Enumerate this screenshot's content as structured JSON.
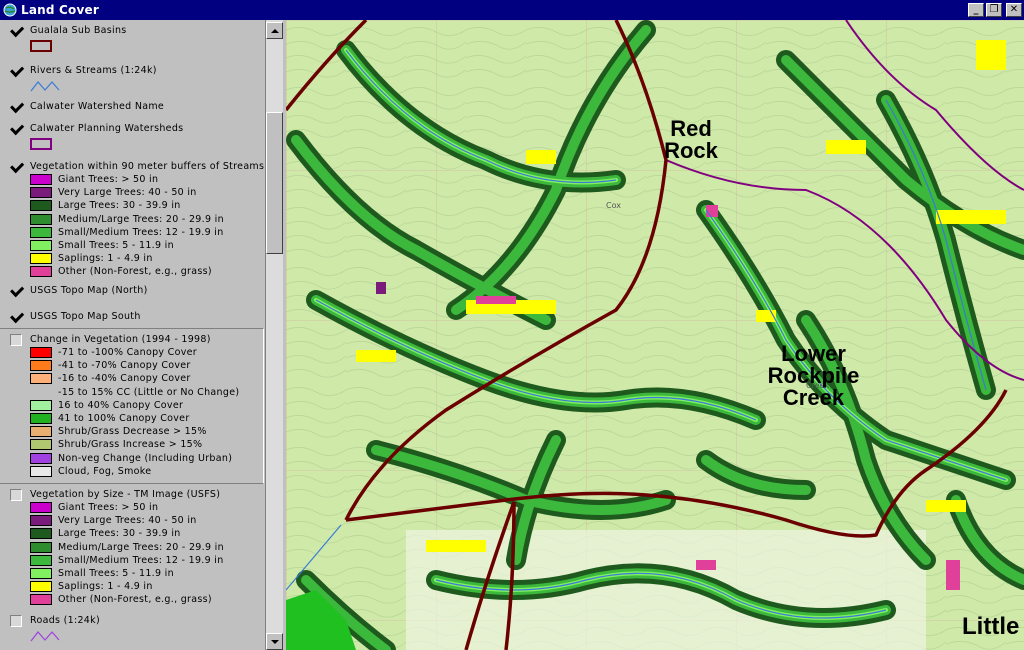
{
  "window": {
    "title": "Land Cover",
    "controls": {
      "minimize": "_",
      "restore": "❐",
      "close": "✕"
    }
  },
  "legend": {
    "basins": {
      "name": "Gualala Sub Basins",
      "checked": true,
      "color": "#6b0000"
    },
    "streams": {
      "name": "Rivers & Streams (1:24k)",
      "checked": true,
      "color": "#3a7ad8"
    },
    "watershed_name": {
      "name": "Calwater Watershed Name",
      "checked": true
    },
    "planning": {
      "name": "Calwater Planning Watersheds",
      "checked": true,
      "color": "#800080"
    },
    "veg_buffers": {
      "name": "Vegetation within 90 meter buffers of Streams",
      "checked": true,
      "entries": [
        {
          "label": "Giant Trees: > 50 in",
          "color": "#cc00cc"
        },
        {
          "label": "Very Large Trees: 40 - 50 in",
          "color": "#7a1a7a"
        },
        {
          "label": "Large Trees: 30 - 39.9 in",
          "color": "#1e5a1e"
        },
        {
          "label": "Medium/Large Trees: 20 - 29.9 in",
          "color": "#2e8b2e"
        },
        {
          "label": "Small/Medium Trees: 12 - 19.9 in",
          "color": "#3cb83c"
        },
        {
          "label": "Small Trees: 5 - 11.9 in",
          "color": "#80f060"
        },
        {
          "label": "Saplings: 1 - 4.9 in",
          "color": "#ffff00"
        },
        {
          "label": "Other (Non-Forest, e.g., grass)",
          "color": "#e0409a"
        }
      ]
    },
    "topo_north": {
      "name": "USGS Topo Map (North)",
      "checked": true
    },
    "topo_south": {
      "name": "USGS Topo Map South",
      "checked": true
    },
    "change": {
      "name": "Change in Vegetation (1994 - 1998)",
      "checked": false,
      "entries": [
        {
          "label": "-71 to -100% Canopy Cover",
          "color": "#ff0000"
        },
        {
          "label": "-41 to -70% Canopy Cover",
          "color": "#ff7a1a"
        },
        {
          "label": "-16 to -40% Canopy Cover",
          "color": "#ffb07a"
        },
        {
          "label": "-15 to 15% CC (Little or No Change)",
          "color": ""
        },
        {
          "label": "16 to 40% Canopy Cover",
          "color": "#a0f0a0"
        },
        {
          "label": "41 to 100% Canopy Cover",
          "color": "#20b020"
        },
        {
          "label": "Shrub/Grass Decrease > 15%",
          "color": "#e8b070"
        },
        {
          "label": "Shrub/Grass Increase > 15%",
          "color": "#b0c870"
        },
        {
          "label": "Non-veg Change (Including Urban)",
          "color": "#a040e0"
        },
        {
          "label": "Cloud, Fog, Smoke",
          "color": "#e8e8e8"
        }
      ]
    },
    "veg_size": {
      "name": "Vegetation by Size - TM Image (USFS)",
      "checked": false,
      "entries": [
        {
          "label": "Giant Trees: > 50 in",
          "color": "#cc00cc"
        },
        {
          "label": "Very Large Trees: 40 - 50 in",
          "color": "#7a1a7a"
        },
        {
          "label": "Large Trees: 30 - 39.9 in",
          "color": "#1e5a1e"
        },
        {
          "label": "Medium/Large Trees: 20 - 29.9 in",
          "color": "#2e8b2e"
        },
        {
          "label": "Small/Medium Trees: 12 - 19.9 in",
          "color": "#3cb83c"
        },
        {
          "label": "Small Trees: 5 - 11.9 in",
          "color": "#80f060"
        },
        {
          "label": "Saplings: 1 - 4.9 in",
          "color": "#ffff00"
        },
        {
          "label": "Other (Non-Forest, e.g., grass)",
          "color": "#e0409a"
        }
      ]
    },
    "roads": {
      "name": "Roads (1:24k)",
      "checked": false
    }
  },
  "map": {
    "labels": {
      "red_rock": "Red Rock",
      "lower_rockpile": "Lower Rockpile Creek",
      "little": "Little"
    }
  }
}
